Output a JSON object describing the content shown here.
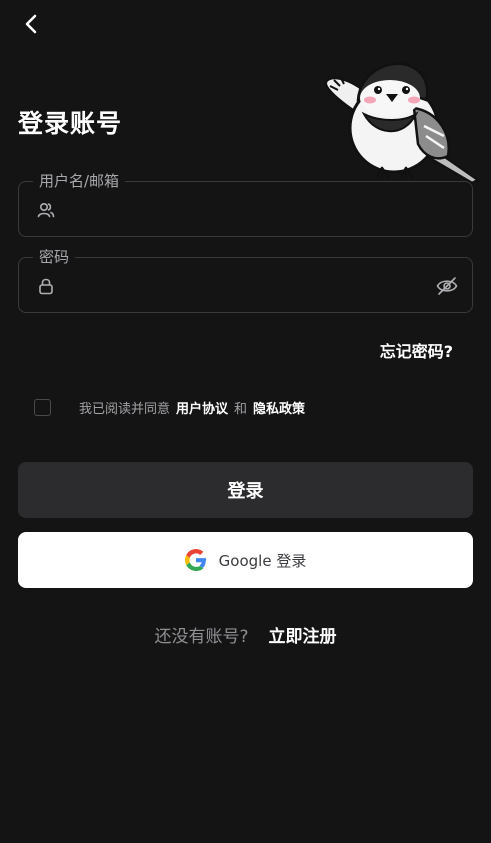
{
  "page": {
    "title": "登录账号"
  },
  "form": {
    "username": {
      "label": "用户名/邮箱",
      "value": "",
      "placeholder": ""
    },
    "password": {
      "label": "密码",
      "value": "",
      "placeholder": ""
    }
  },
  "links": {
    "forgot": "忘记密码?"
  },
  "agreement": {
    "prefix": "我已阅读并同意",
    "terms": "用户协议",
    "and": "和",
    "privacy": "隐私政策"
  },
  "buttons": {
    "login": "登录",
    "google": "Google 登录"
  },
  "signup": {
    "question": "还没有账号?",
    "action": "立即注册"
  },
  "colors": {
    "background": "#151415",
    "button_dark": "#2c2c2e",
    "button_light": "#ffffff"
  },
  "icons": {
    "back": "chevron-left-icon",
    "user": "user-icon",
    "lock": "lock-icon",
    "eye": "eye-off-icon",
    "google": "google-logo-icon"
  }
}
